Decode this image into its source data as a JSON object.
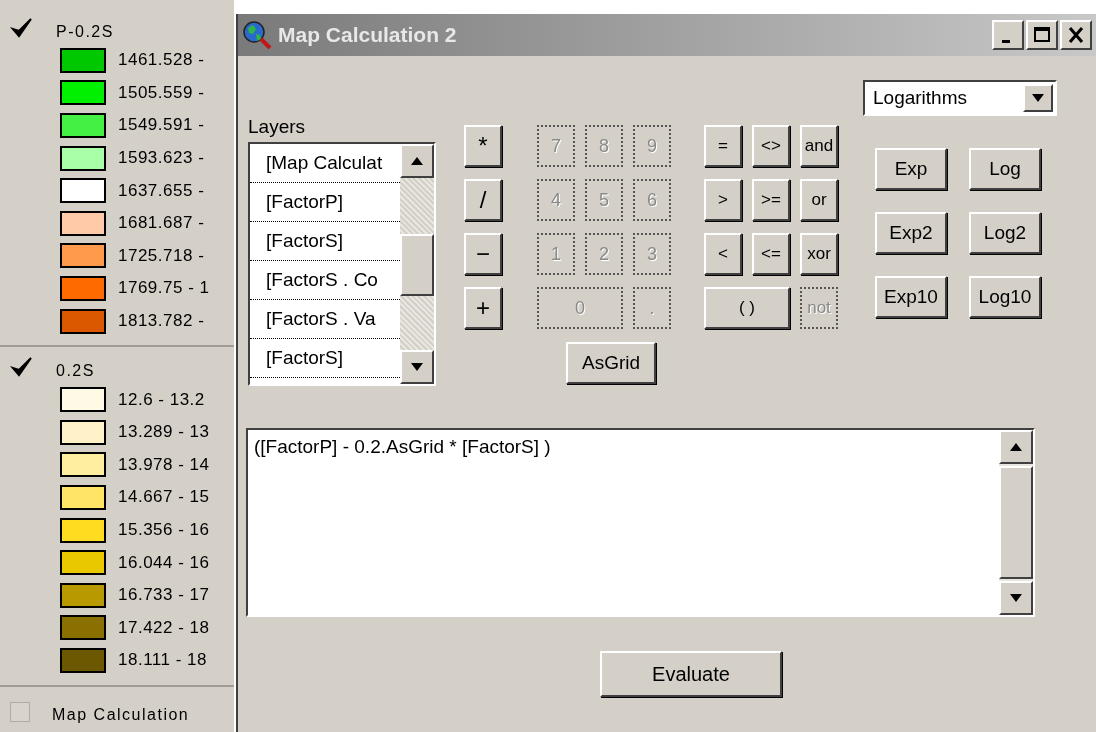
{
  "legend": [
    {
      "name": "P-0.2S",
      "checked": true,
      "classes": [
        {
          "label": "1461.528 -",
          "color": "#00c800"
        },
        {
          "label": "1505.559 -",
          "color": "#00f000"
        },
        {
          "label": "1549.591 -",
          "color": "#44f044"
        },
        {
          "label": "1593.623 -",
          "color": "#a8ffa8"
        },
        {
          "label": "1637.655 -",
          "color": "#ffffff"
        },
        {
          "label": "1681.687 -",
          "color": "#ffcaa8"
        },
        {
          "label": "1725.718 -",
          "color": "#ff9a4c"
        },
        {
          "label": "1769.75 - 1",
          "color": "#ff6a00"
        },
        {
          "label": "1813.782 -",
          "color": "#dc5800"
        }
      ]
    },
    {
      "name": "0.2S",
      "checked": true,
      "classes": [
        {
          "label": "12.6 - 13.2",
          "color": "#fffae6"
        },
        {
          "label": "13.289 - 13",
          "color": "#fff2c8"
        },
        {
          "label": "13.978 - 14",
          "color": "#ffeea0"
        },
        {
          "label": "14.667 - 15",
          "color": "#ffe466"
        },
        {
          "label": "15.356 - 16",
          "color": "#ffdc20"
        },
        {
          "label": "16.044 - 16",
          "color": "#eac800"
        },
        {
          "label": "16.733 - 17",
          "color": "#b89a00"
        },
        {
          "label": "17.422 - 18",
          "color": "#8a7000"
        },
        {
          "label": "18.111 - 18",
          "color": "#6c5800"
        }
      ]
    },
    {
      "name": "Map Calculation",
      "checked": false
    }
  ],
  "dialog": {
    "title": "Map Calculation 2",
    "layers_label": "Layers",
    "layers": [
      "[Map Calculat",
      "[FactorP]",
      "[FactorS]",
      "[FactorS . Co",
      "[FactorS . Va",
      "[FactorS]"
    ],
    "operators": [
      {
        "label": "*",
        "disabled": false
      },
      {
        "label": "/",
        "disabled": false
      },
      {
        "label": "−",
        "disabled": false
      },
      {
        "label": "+",
        "disabled": false
      }
    ],
    "digits": [
      {
        "label": "7",
        "disabled": true
      },
      {
        "label": "8",
        "disabled": true
      },
      {
        "label": "9",
        "disabled": true
      },
      {
        "label": "4",
        "disabled": true
      },
      {
        "label": "5",
        "disabled": true
      },
      {
        "label": "6",
        "disabled": true
      },
      {
        "label": "1",
        "disabled": true
      },
      {
        "label": "2",
        "disabled": true
      },
      {
        "label": "3",
        "disabled": true
      },
      {
        "label": "0",
        "disabled": true,
        "wide": true
      },
      {
        "label": ".",
        "disabled": true
      }
    ],
    "asgrid": "AsGrid",
    "comparisons": [
      {
        "label": "=",
        "disabled": false
      },
      {
        "label": "<>",
        "disabled": false
      },
      {
        "label": "and",
        "disabled": false
      },
      {
        "label": ">",
        "disabled": false
      },
      {
        "label": ">=",
        "disabled": false
      },
      {
        "label": "or",
        "disabled": false
      },
      {
        "label": "<",
        "disabled": false
      },
      {
        "label": "<=",
        "disabled": false
      },
      {
        "label": "xor",
        "disabled": false
      },
      {
        "label": "( )",
        "disabled": false,
        "wide": true
      },
      {
        "label": "not",
        "disabled": true
      }
    ],
    "function_group": "Logarithms",
    "functions": [
      "Exp",
      "Log",
      "Exp2",
      "Log2",
      "Exp10",
      "Log10"
    ],
    "expression": "([FactorP] - 0.2.AsGrid * [FactorS] )",
    "evaluate": "Evaluate"
  }
}
